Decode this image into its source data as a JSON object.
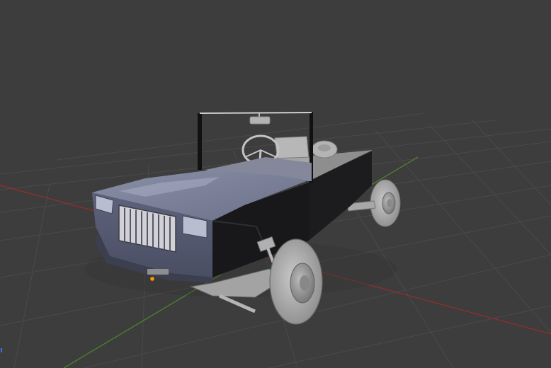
{
  "viewport": {
    "label": "",
    "background_color": "#3d3d3d",
    "grid_color": "#4a4a4a",
    "x_axis_color": "#9a2c2c",
    "y_axis_color": "#4b8b2c",
    "origin_color": "#f39c12"
  },
  "scene": {
    "object": "jeep-model",
    "icons": {
      "origin": "origin-dot-icon",
      "axis_gizmo": "axis-gizmo-icon"
    }
  }
}
